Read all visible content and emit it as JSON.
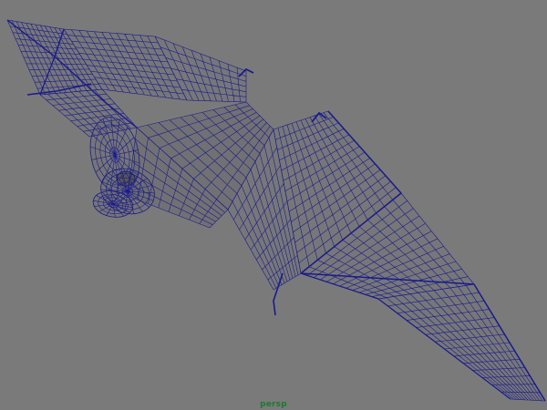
{
  "viewport": {
    "camera_name": "persp",
    "background_color": "#7a7a7a",
    "wire_color": "#1a1a8c",
    "label_color": "#1c7a2e"
  },
  "model": {
    "subject": "bat",
    "display": "wireframe"
  }
}
